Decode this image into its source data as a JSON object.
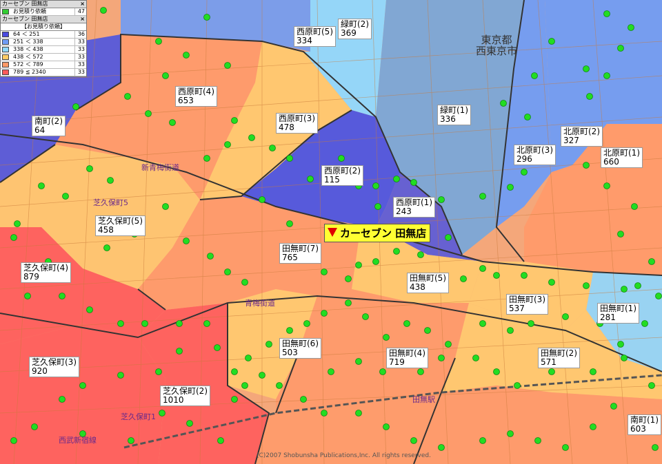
{
  "legend1": {
    "title": "カーセブン 田無店",
    "close": "×",
    "row_label": "お見積り依頼",
    "row_count": "47",
    "swatch": "#33cc33"
  },
  "legend2": {
    "title": "カーセブン 田無店",
    "close": "×",
    "subtitle": "【お見積り依頼】",
    "rows": [
      {
        "range": "64 ＜ 251",
        "count": "36",
        "color": "#4a4adf"
      },
      {
        "range": "251 ＜ 338",
        "count": "33",
        "color": "#6f9cf5"
      },
      {
        "range": "338 ＜ 438",
        "count": "33",
        "color": "#8fd8ff"
      },
      {
        "range": "438 ＜ 572",
        "count": "33",
        "color": "#ffcc66"
      },
      {
        "range": "572 ＜ 789",
        "count": "33",
        "color": "#ff9966"
      },
      {
        "range": "789 ≦ 2340",
        "count": "33",
        "color": "#ff5a5a"
      }
    ]
  },
  "store": {
    "name": "カーセブン 田無店"
  },
  "city": {
    "line1": "東京都",
    "line2": "西東京市"
  },
  "copyright": "(C)2007 Shobunsha Publications,Inc. All rights reserved.",
  "streets": [
    "新青梅街道",
    "青梅街道",
    "芝久保町5",
    "芝久保町1",
    "西武新宿線",
    "田無駅"
  ],
  "areas": [
    {
      "name": "西原町(5)",
      "value": "334"
    },
    {
      "name": "緑町(2)",
      "value": "369"
    },
    {
      "name": "西原町(4)",
      "value": "653"
    },
    {
      "name": "南町(2)",
      "value": "64"
    },
    {
      "name": "西原町(3)",
      "value": "478"
    },
    {
      "name": "緑町(1)",
      "value": "336"
    },
    {
      "name": "北原町(2)",
      "value": "327"
    },
    {
      "name": "北原町(3)",
      "value": "296"
    },
    {
      "name": "北原町(1)",
      "value": "660"
    },
    {
      "name": "西原町(2)",
      "value": "115"
    },
    {
      "name": "西原町(1)",
      "value": "243"
    },
    {
      "name": "芝久保町(5)",
      "value": "458"
    },
    {
      "name": "田無町(7)",
      "value": "765"
    },
    {
      "name": "芝久保町(4)",
      "value": "879"
    },
    {
      "name": "田無町(5)",
      "value": "438"
    },
    {
      "name": "田無町(3)",
      "value": "537"
    },
    {
      "name": "田無町(1)",
      "value": "281"
    },
    {
      "name": "田無町(6)",
      "value": "503"
    },
    {
      "name": "田無町(4)",
      "value": "719"
    },
    {
      "name": "田無町(2)",
      "value": "571"
    },
    {
      "name": "芝久保町(3)",
      "value": "920"
    },
    {
      "name": "芝久保町(2)",
      "value": "1010"
    },
    {
      "name": "南町(1)",
      "value": "603"
    }
  ]
}
